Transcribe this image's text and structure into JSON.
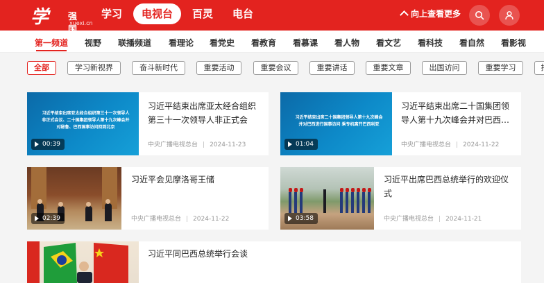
{
  "header": {
    "logo": {
      "main": "学习",
      "sub": "强国",
      "url": "xuexi.cn"
    },
    "nav": [
      {
        "label": "学习",
        "active": false
      },
      {
        "label": "电视台",
        "active": true
      },
      {
        "label": "百灵",
        "active": false
      },
      {
        "label": "电台",
        "active": false
      }
    ],
    "up_more_label": "向上查看更多",
    "accent_color": "#e3231f"
  },
  "channels": [
    "第一频道",
    "视野",
    "联播频道",
    "看理论",
    "看党史",
    "看教育",
    "看慕课",
    "看人物",
    "看文艺",
    "看科技",
    "看自然",
    "看影视"
  ],
  "tags": [
    "全部",
    "学习新视界",
    "奋斗新时代",
    "重要活动",
    "重要会议",
    "重要讲话",
    "重要文章",
    "出国访问",
    "重要学习",
    "指"
  ],
  "cards": [
    {
      "title": "习近平结束出席亚太经合组织第三十一次领导人非正式会议…",
      "thumb_text": "习近平结束出席亚太经合组织第三十一次领导人非正式会议、二十国集团领导人第十九次峰会并对秘鲁、巴西国事访问回到北京",
      "duration": "00:39",
      "source": "中央广播电视总台",
      "date": "2024-11-23"
    },
    {
      "title": "习近平结束出席二十国集团领导人第十九次峰会并对巴西…",
      "thumb_text": "习近平结束出席二十国集团领导人第十九次峰会并对巴西进行国事访问 乘专机离开巴西利亚",
      "duration": "01:04",
      "source": "中央广播电视总台",
      "date": "2024-11-22"
    },
    {
      "title": "习近平会见摩洛哥王储",
      "duration": "02:39",
      "source": "中央广播电视总台",
      "date": "2024-11-22"
    },
    {
      "title": "习近平出席巴西总统举行的欢迎仪式",
      "duration": "03:58",
      "source": "中央广播电视总台",
      "date": "2024-11-21"
    },
    {
      "title": "习近平同巴西总统举行会谈"
    }
  ]
}
